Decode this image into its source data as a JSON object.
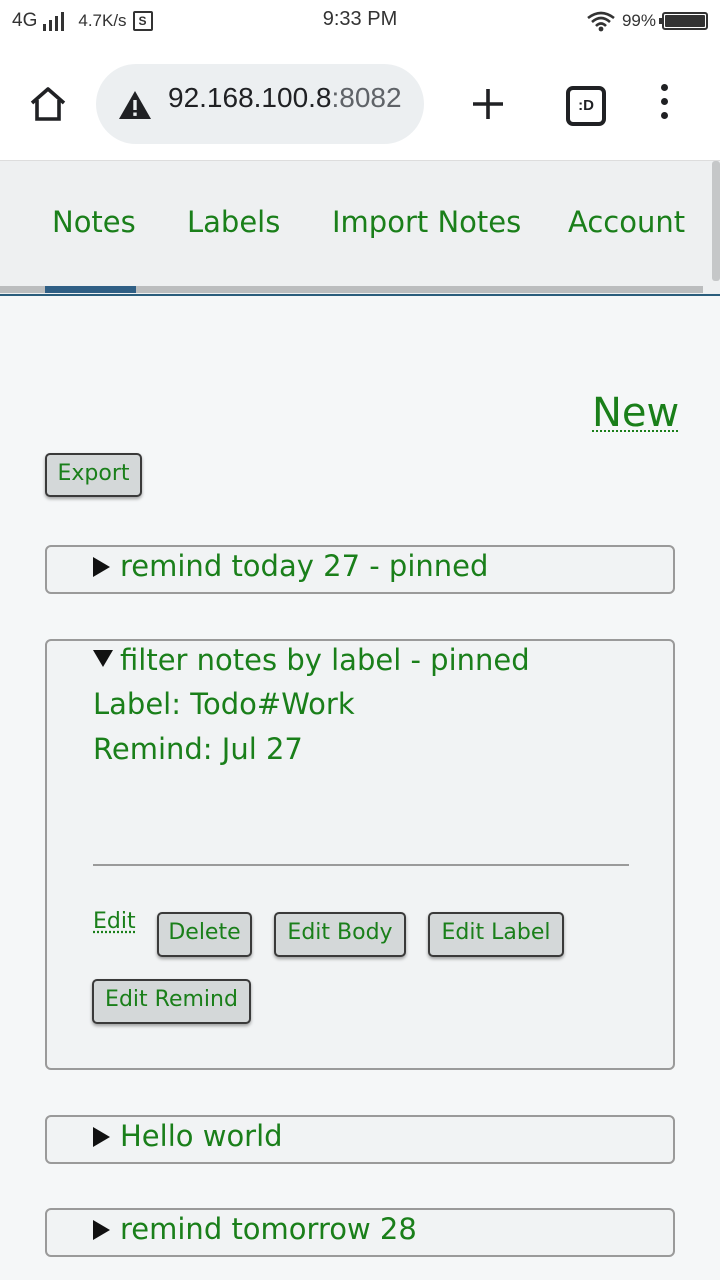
{
  "status_bar": {
    "network": "4G",
    "speed": "4.7K/s",
    "speed_icon": "S",
    "time": "9:33 PM",
    "battery": "99%",
    "battery_level": 0.99
  },
  "browser": {
    "url_host": "92.168.100.8",
    "url_port": ":8082",
    "tabs_icon": ":D"
  },
  "nav": {
    "items": [
      {
        "label": "Notes"
      },
      {
        "label": "Labels"
      },
      {
        "label": "Import Notes"
      },
      {
        "label": "Account"
      }
    ]
  },
  "main": {
    "new_label": "New",
    "export_label": "Export"
  },
  "notes": [
    {
      "title": "remind today 27 - pinned",
      "expanded": false
    },
    {
      "title": "filter notes by label - pinned",
      "expanded": true,
      "label_line": "Label: Todo#Work",
      "remind_line": "Remind: Jul 27",
      "actions": {
        "edit": "Edit",
        "delete": "Delete",
        "edit_body": "Edit Body",
        "edit_label": "Edit Label",
        "edit_remind": "Edit Remind"
      }
    },
    {
      "title": "Hello world",
      "expanded": false
    },
    {
      "title": "remind tomorrow 28",
      "expanded": false
    }
  ],
  "colors": {
    "link_green": "#1a7f1a",
    "nav_accent": "#2f5f85"
  }
}
